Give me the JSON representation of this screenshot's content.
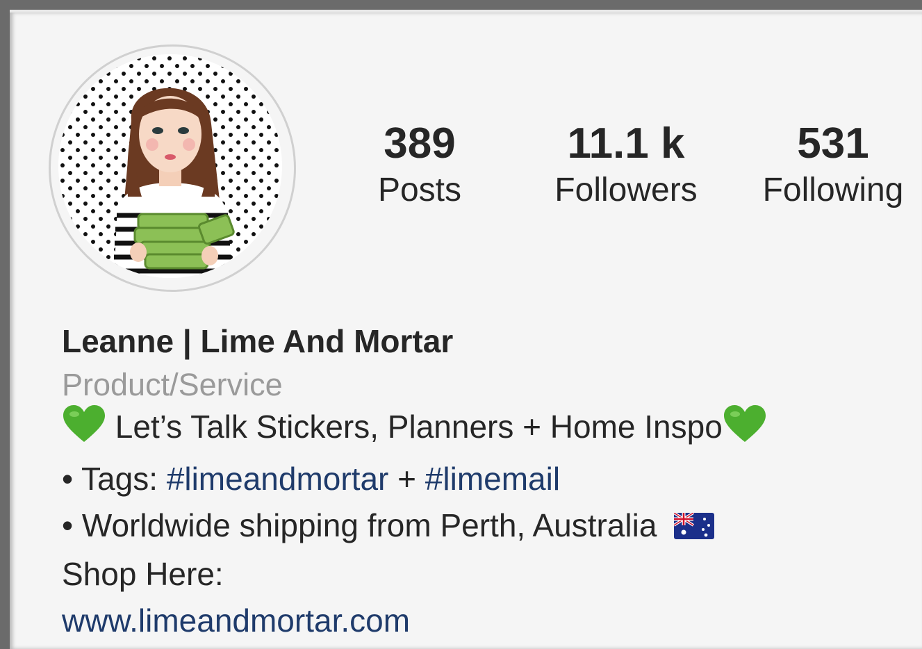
{
  "profile": {
    "stats": [
      {
        "value": "389",
        "label": "Posts"
      },
      {
        "value": "11.1 k",
        "label": "Followers"
      },
      {
        "value": "531",
        "label": "Following"
      }
    ],
    "name": "Leanne | Lime And Mortar",
    "category": "Product/Service",
    "bio": {
      "line1": "Let’s Talk Stickers, Planners + Home Inspo",
      "tags_prefix": "• Tags: ",
      "tag1": "#limeandmortar",
      "tags_sep": " + ",
      "tag2": "#limemail",
      "shipping": "• Worldwide shipping from Perth, Australia",
      "shop_label": "Shop Here:",
      "website": "www.limeandmortar.com"
    },
    "icons": {
      "heart": "green-heart-icon",
      "flag": "australia-flag-icon"
    },
    "colors": {
      "heart": "#4caf2f",
      "link": "#1f3b6b",
      "category": "#9a9a9a"
    }
  }
}
